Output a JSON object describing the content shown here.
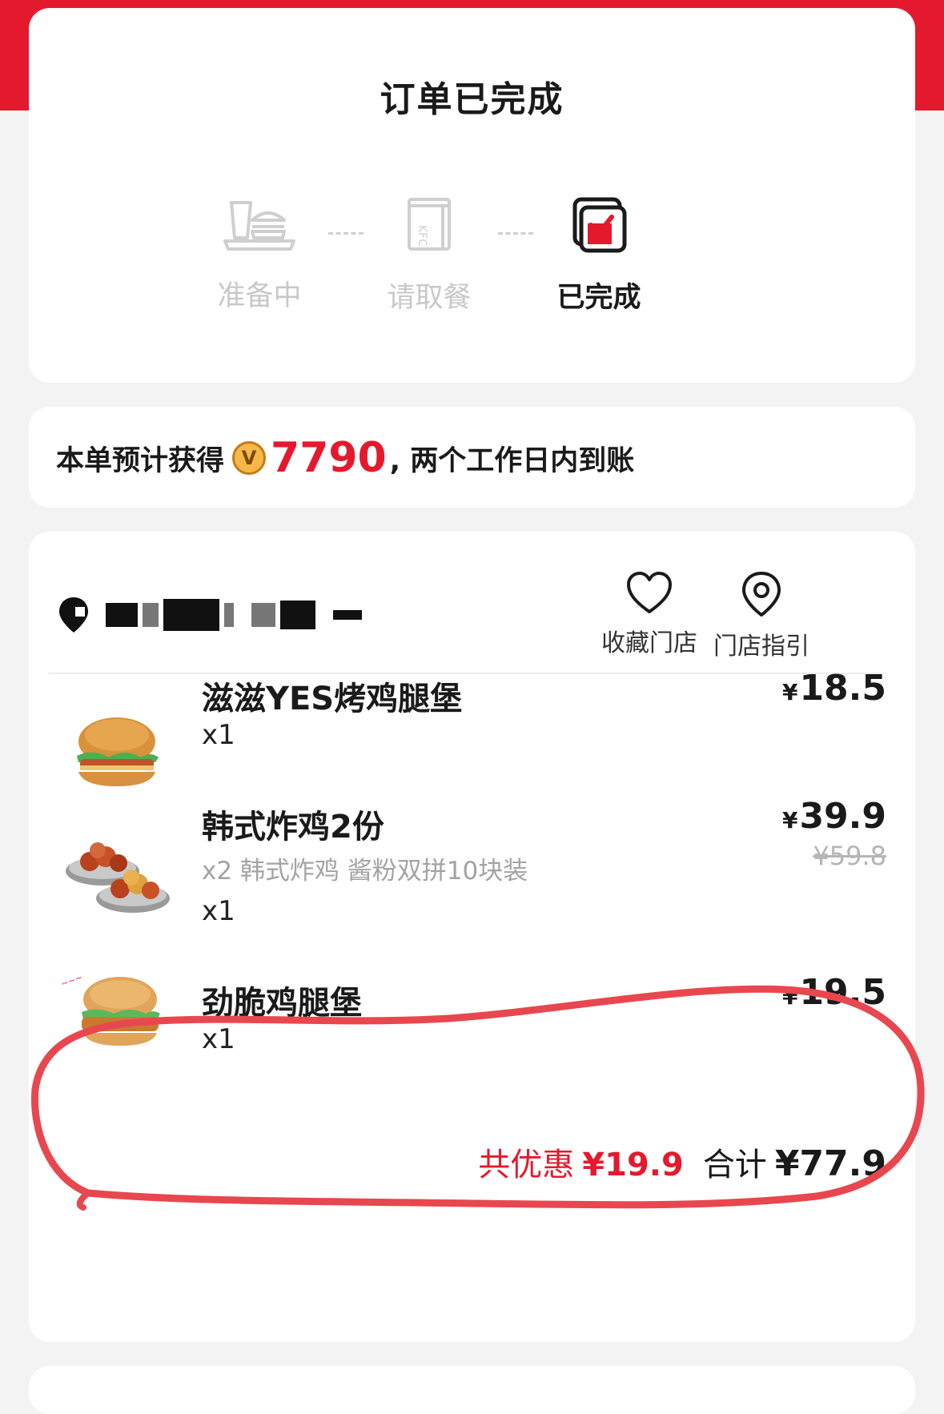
{
  "header": {
    "title": "订单已完成"
  },
  "steps": [
    {
      "label": "准备中",
      "state": "done",
      "icon": "meal-tray-icon"
    },
    {
      "label": "请取餐",
      "state": "done",
      "icon": "kfc-bag-icon"
    },
    {
      "label": "已完成",
      "state": "current",
      "icon": "completed-check-icon"
    }
  ],
  "points": {
    "prefix": "本单预计获得",
    "coin_symbol": "V",
    "value": "7790",
    "suffix": ", 两个工作日内到账"
  },
  "store": {
    "name_censored": true,
    "favorite_label": "收藏门店",
    "guide_label": "门店指引"
  },
  "items": [
    {
      "name": "滋滋YES烤鸡腿堡",
      "qty": "x1",
      "currency": "¥",
      "price": "18.5"
    },
    {
      "name": "韩式炸鸡2份",
      "desc": "x2 韩式炸鸡 酱粉双拼10块装",
      "qty": "x1",
      "currency": "¥",
      "price": "39.9",
      "original_price": "¥59.8"
    },
    {
      "name": "劲脆鸡腿堡",
      "qty": "x1",
      "currency": "¥",
      "price": "19.5",
      "highlighted": true
    }
  ],
  "summary": {
    "discount_label": "共优惠",
    "discount_value": "¥19.9",
    "total_label": "合计",
    "total_value": "¥77.9"
  },
  "colors": {
    "brand": "#e5192d",
    "annotation": "#e8474f"
  }
}
